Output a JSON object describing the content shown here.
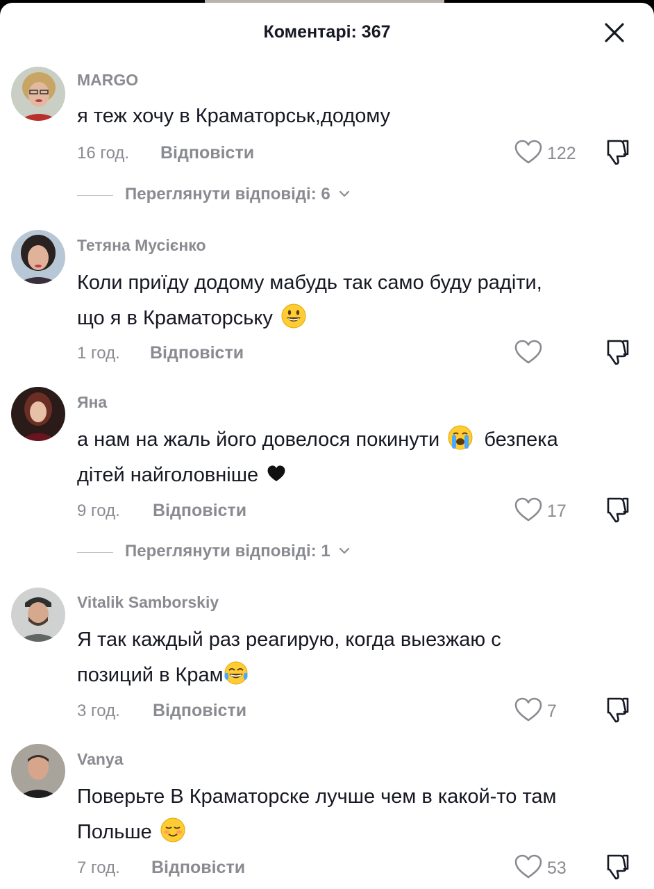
{
  "sheet": {
    "title": "Коментарі: 367"
  },
  "actions": {
    "reply_label": "Відповісти"
  },
  "comments": [
    {
      "username": "MARGO",
      "text": "я теж хочу в Краматорськ,додому",
      "time": "16 год.",
      "likes": "122",
      "view_replies": "Переглянути відповіді: 6"
    },
    {
      "username": "Тетяна Мусієнко",
      "text_line1": "Коли приїду додому мабудь так само буду радіти,",
      "text_line2": "що я в Краматорську",
      "emoji": "smiling-face-emoji",
      "time": "1 год.",
      "likes": ""
    },
    {
      "username": "Яна",
      "text_line1a": "а нам на жаль його довелося покинути",
      "text_line1b": "безпека",
      "text_line2": "дітей найголовніше",
      "emoji1": "loudly-crying-face-emoji",
      "emoji2": "black-heart-emoji",
      "time": "9 год.",
      "likes": "17",
      "view_replies": "Переглянути відповіді: 1"
    },
    {
      "username": "Vitalik Samborskiy",
      "text_line1": "Я так каждый раз реагирую, когда выезжаю с",
      "text_line2": "позиций в Крам",
      "emoji": "tears-of-joy-emoji",
      "time": "3 год.",
      "likes": "7"
    },
    {
      "username": "Vanya",
      "text_line1": "Поверьте В Краматорске лучше чем в какой-то там",
      "text_line2": "Польше",
      "emoji": "smiling-blush-emoji",
      "time": "7 год.",
      "likes": "53"
    }
  ],
  "colors": {
    "text": "#161823",
    "secondary": "#8a8b91",
    "background": "#ffffff"
  }
}
